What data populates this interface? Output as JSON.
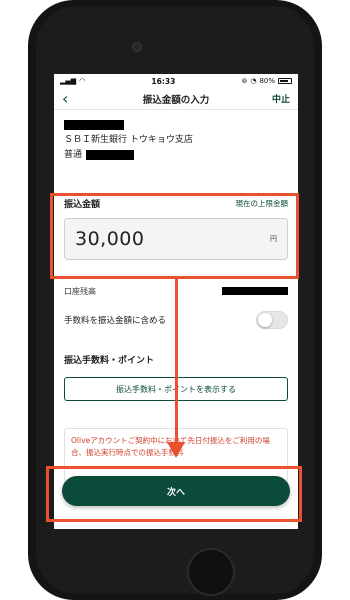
{
  "status_bar": {
    "time": "16:33",
    "battery_text": "80%",
    "icons": [
      "signal-icon",
      "wifi-icon",
      "alarm-icon",
      "battery-icon"
    ]
  },
  "nav": {
    "back_icon": "chevron-left-icon",
    "title": "振込金額の入力",
    "cancel_label": "中止"
  },
  "recipient": {
    "bank_branch": "ＳＢＩ新生銀行 トウキョウ支店",
    "account_type": "普通"
  },
  "amount": {
    "label": "振込金額",
    "limit_link": "現在の上限金額",
    "value": "30,000",
    "unit": "円"
  },
  "balance": {
    "label": "口座残高"
  },
  "fee_toggle": {
    "label": "手数料を振込金額に含める",
    "state": "off"
  },
  "fee_section": {
    "heading": "振込手数料・ポイント",
    "button_label": "振込手数料・ポイントを表示する"
  },
  "notice": {
    "text": "Oliveアカウントご契約中において先日付振込をご利用の場合、振込実行時点での振込手数料"
  },
  "next_button": {
    "label": "次へ"
  },
  "colors": {
    "brand_green": "#0b4b3a",
    "highlight_orange": "#e8502e",
    "notice_red": "#d23c2a"
  }
}
